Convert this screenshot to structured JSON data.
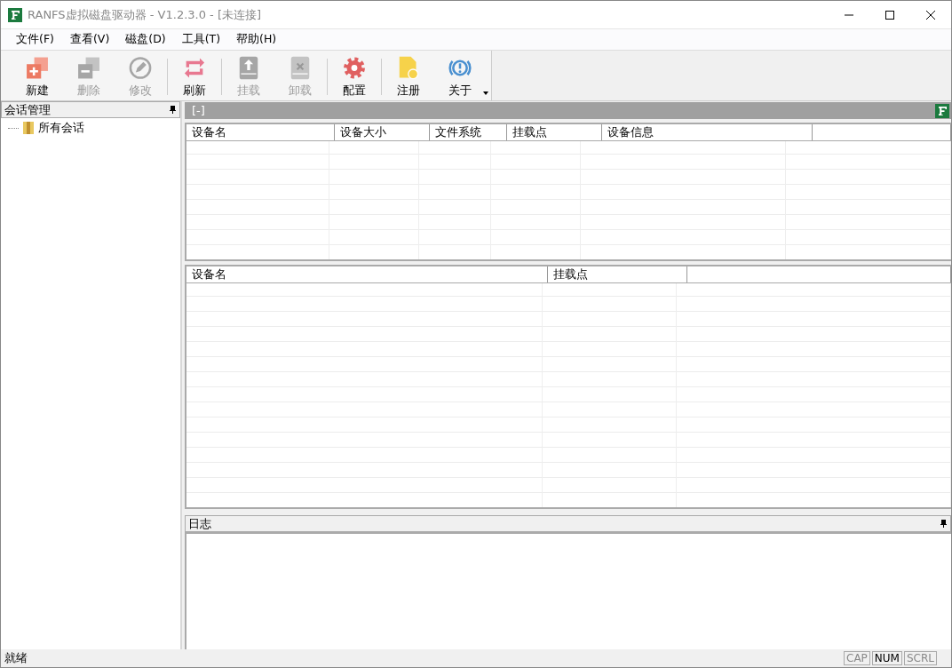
{
  "window": {
    "title": "RANFS虚拟磁盘驱动器 - V1.2.3.0 - [未连接]"
  },
  "menu": [
    "文件(F)",
    "查看(V)",
    "磁盘(D)",
    "工具(T)",
    "帮助(H)"
  ],
  "toolbar": [
    {
      "kind": "new",
      "label": "新建",
      "disabled": false
    },
    {
      "kind": "delete",
      "label": "删除",
      "disabled": true
    },
    {
      "kind": "edit",
      "label": "修改",
      "disabled": true
    },
    {
      "kind": "separator"
    },
    {
      "kind": "refresh",
      "label": "刷新",
      "disabled": false
    },
    {
      "kind": "separator"
    },
    {
      "kind": "mount",
      "label": "挂载",
      "disabled": true
    },
    {
      "kind": "unmount",
      "label": "卸载",
      "disabled": true
    },
    {
      "kind": "separator"
    },
    {
      "kind": "settings",
      "label": "配置",
      "disabled": false
    },
    {
      "kind": "separator"
    },
    {
      "kind": "register",
      "label": "注册",
      "disabled": false
    },
    {
      "kind": "about",
      "label": "关于",
      "disabled": false
    }
  ],
  "sidebar": {
    "title": "会话管理",
    "items": [
      {
        "label": "所有会话"
      }
    ]
  },
  "content": {
    "header": "[-]",
    "device_table": {
      "columns": [
        "设备名",
        "设备大小",
        "文件系统",
        "挂载点",
        "设备信息"
      ]
    },
    "mount_table": {
      "columns": [
        "设备名",
        "挂载点"
      ]
    }
  },
  "log": {
    "title": "日志"
  },
  "status_bar": {
    "text": "就绪",
    "indicators": [
      {
        "label": "CAP",
        "on": false
      },
      {
        "label": "NUM",
        "on": true
      },
      {
        "label": "SCRL",
        "on": false
      }
    ]
  }
}
